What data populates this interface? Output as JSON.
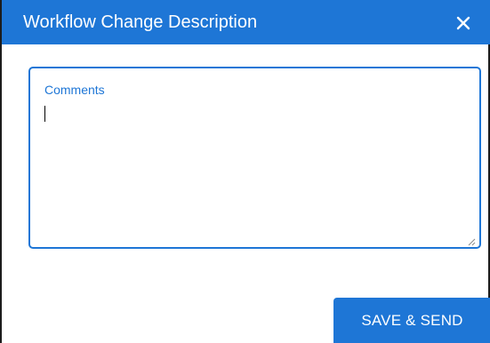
{
  "dialog": {
    "title": "Workflow Change Description",
    "close_icon": "close-icon",
    "accent_color": "#1e76d6"
  },
  "comments": {
    "label": "Comments",
    "value": ""
  },
  "actions": {
    "save_send_label": "SAVE & SEND"
  }
}
